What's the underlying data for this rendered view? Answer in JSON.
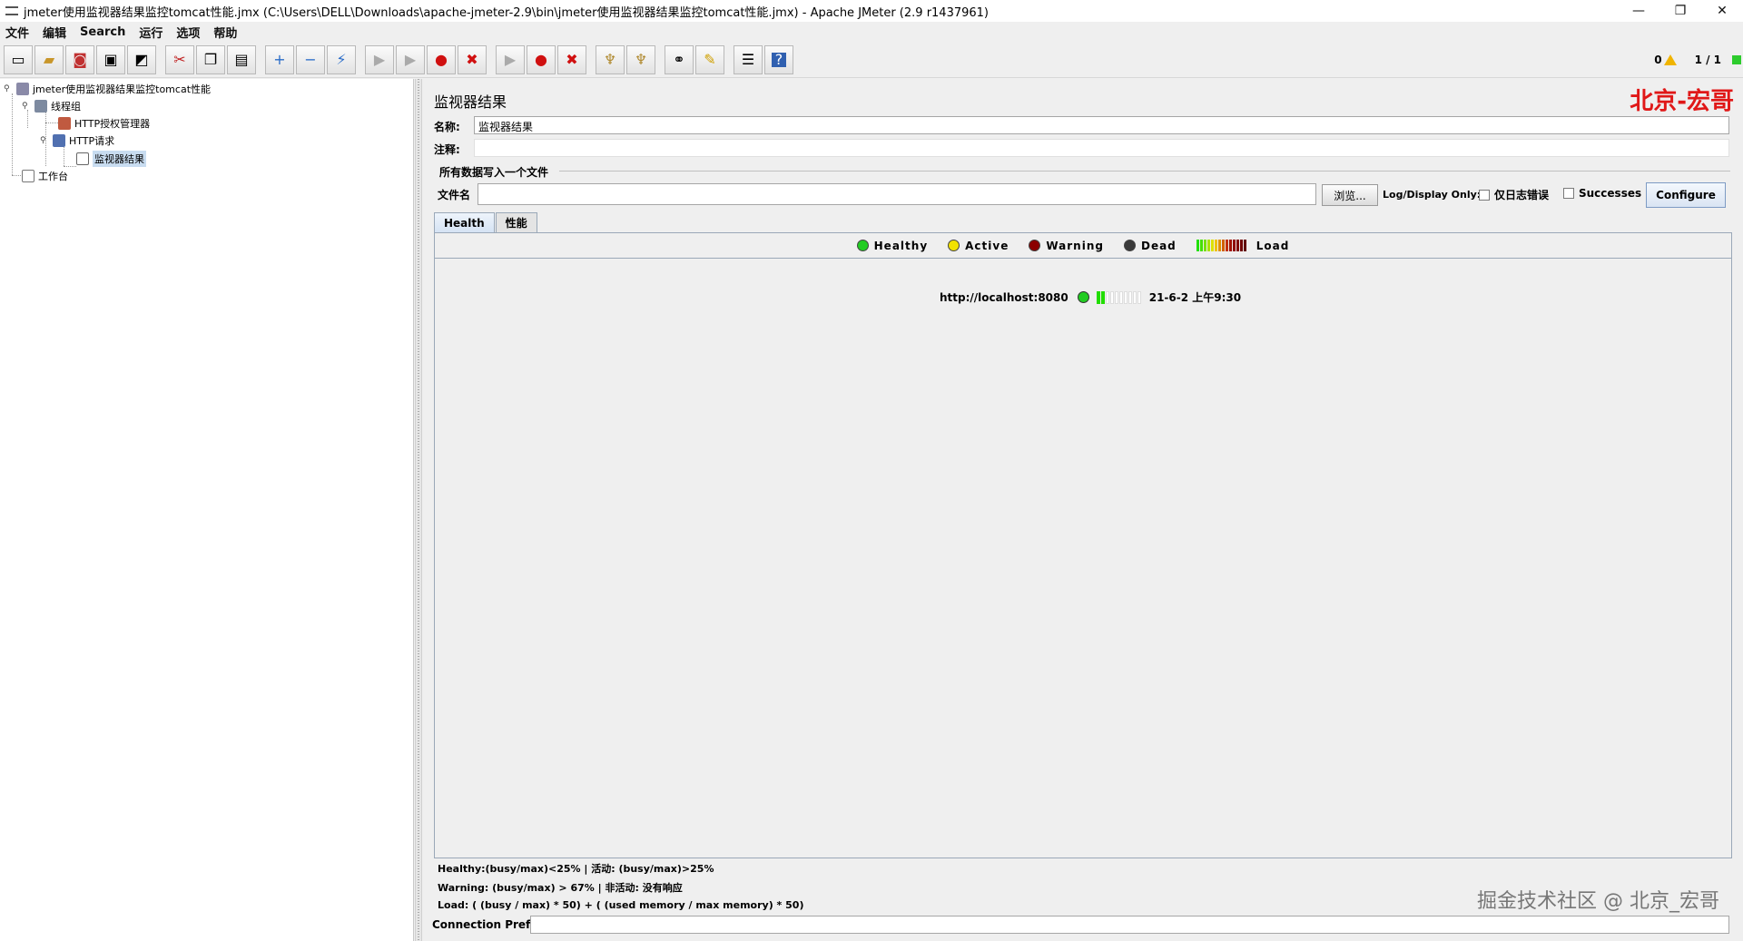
{
  "window": {
    "title": "jmeter使用监视器结果监控tomcat性能.jmx (C:\\Users\\DELL\\Downloads\\apache-jmeter-2.9\\bin\\jmeter使用监视器结果监控tomcat性能.jmx) - Apache JMeter (2.9 r1437961)",
    "minimize": "—",
    "restore": "❐",
    "close": "✕"
  },
  "menu": [
    "文件",
    "编辑",
    "Search",
    "运行",
    "选项",
    "帮助"
  ],
  "toolbar": {
    "status_errors": "0",
    "status_threads": "1 / 1"
  },
  "tree": {
    "root": "jmeter使用监视器结果监控tomcat性能",
    "thread_group": "线程组",
    "auth_manager": "HTTP授权管理器",
    "http_request": "HTTP请求",
    "monitor": "监视器结果",
    "workbench": "工作台"
  },
  "panel": {
    "title": "监视器结果",
    "watermark_top": "北京-宏哥",
    "name_label": "名称:",
    "name_value": "监视器结果",
    "comment_label": "注释:",
    "comment_value": "",
    "file_group_title": "所有数据写入一个文件",
    "filename_label": "文件名",
    "filename_value": "",
    "browse_label": "浏览...",
    "log_display_label": "Log/Display Only:",
    "errors_only_label": "仅日志错误",
    "successes_label": "Successes",
    "configure_label": "Configure"
  },
  "tabs": [
    "Health",
    "性能"
  ],
  "legend": {
    "healthy": "Healthy",
    "active": "Active",
    "warning": "Warning",
    "dead": "Dead",
    "load": "Load"
  },
  "server": {
    "url": "http://localhost:8080",
    "time": "21-6-2 上午9:30",
    "load_fraction": 0.2
  },
  "info": {
    "line1": "Healthy:(busy/max)<25%  |  活动:  (busy/max)>25%",
    "line2": "Warning:  (busy/max) > 67%  |  非活动:  没有响应",
    "line3": "Load:  ( (busy / max) * 50) + ( (used memory / max memory) * 50)"
  },
  "watermark_bottom": "掘金技术社区 @ 北京_宏哥",
  "connection_prefix_label": "Connection Prefix",
  "colors": {
    "healthy": "#22cc22",
    "active": "#f2e200",
    "warning": "#8b0000",
    "dead": "#3a3a3a",
    "brand_red": "#e01818"
  }
}
